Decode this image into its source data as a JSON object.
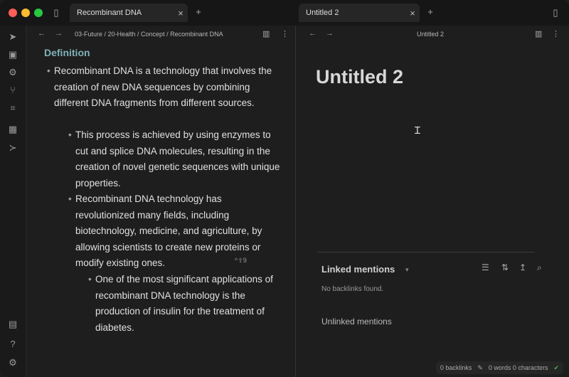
{
  "tabs": {
    "left": {
      "label": "Recombinant DNA",
      "close": "×"
    },
    "new_left": "+",
    "right": {
      "label": "Untitled 2",
      "close": "×"
    },
    "new_right": "+"
  },
  "left_pane": {
    "breadcrumb": "03-Future / 20-Health / Concept / Recombinant DNA",
    "heading": "Definition",
    "bullets": [
      {
        "level": 1,
        "text": "Recombinant DNA is a technology that involves the creation of new DNA sequences by combining different DNA fragments from different sources."
      },
      {
        "level": 2,
        "text": "This process is achieved by using enzymes to cut and splice DNA molecules, resulting in the creation of novel genetic sequences with unique properties."
      },
      {
        "level": 2,
        "text": "Recombinant DNA technology has revolutionized many fields, including biotechnology, medicine, and agriculture, by allowing scientists to create new proteins or modify existing ones."
      },
      {
        "level": 3,
        "text": "One of the most significant applications of recombinant DNA technology is the production of insulin for the treatment of diabetes."
      }
    ],
    "shortcut_hint": "^⇧9"
  },
  "right_pane": {
    "title_bar": "Untitled 2",
    "note_title": "Untitled 2",
    "linked_mentions": "Linked mentions",
    "no_backlinks": "No backlinks found.",
    "unlinked_mentions": "Unlinked mentions"
  },
  "status_bar": {
    "backlinks": "0 backlinks",
    "words": "0 words 0 characters"
  },
  "icons": {
    "ribbon": [
      "send-icon",
      "layout-icon",
      "graph-icon",
      "fork-icon",
      "grid-icon",
      "calendar-icon",
      "terminal-icon",
      "vault-icon",
      "help-icon",
      "settings-icon"
    ]
  },
  "colors": {
    "heading": "#7fb2b8",
    "background": "#1e1e1e",
    "sync": "#4caf50"
  }
}
